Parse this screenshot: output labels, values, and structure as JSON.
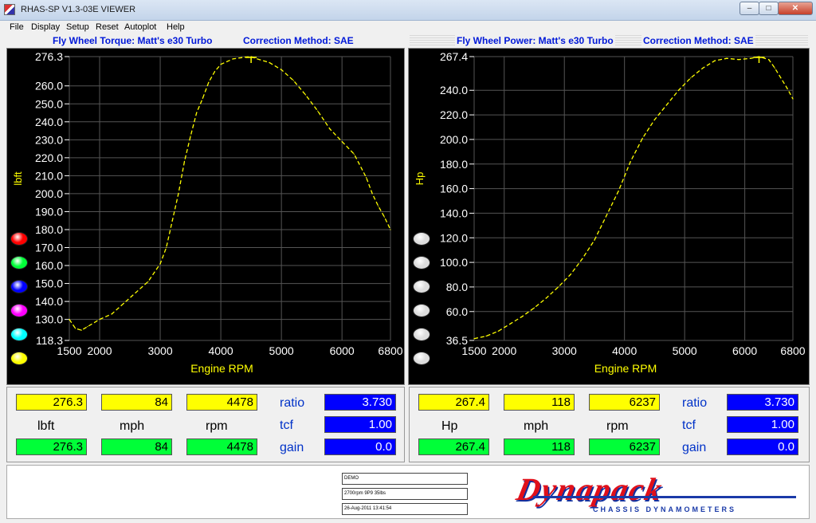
{
  "window": {
    "title": "RHAS-SP V1.3-03E VIEWER",
    "min": "–",
    "max": "□",
    "close": "✕"
  },
  "menu": [
    "File",
    "Display",
    "Setup",
    "Reset",
    "Autoplot",
    "Help"
  ],
  "colors": {
    "trace": "#ffff00",
    "grid": "#555555",
    "axis_text": "#ffffff",
    "axis_label": "#ffff00",
    "title": "#0018d8"
  },
  "torque_panel": {
    "title": "Fly Wheel Torque: Matt's e30 Turbo",
    "method": "Correction Method: SAE",
    "y_unit": "lbft",
    "x_label": "Engine RPM",
    "dots": [
      "#ff0000",
      "#00ff38",
      "#0000ff",
      "#ff00ff",
      "#00ffff",
      "#ffff00"
    ]
  },
  "power_panel": {
    "title": "Fly Wheel Power: Matt's e30 Turbo",
    "method": "Correction Method: SAE",
    "y_unit": "Hp",
    "x_label": "Engine RPM",
    "dots": [
      "#dddddd",
      "#dddddd",
      "#dddddd",
      "#dddddd",
      "#dddddd",
      "#dddddd"
    ]
  },
  "chart_data": [
    {
      "type": "line",
      "title": "Fly Wheel Torque: Matt's e30 Turbo",
      "xlabel": "Engine RPM",
      "ylabel": "lbft",
      "xlim": [
        1500,
        6800
      ],
      "ylim": [
        118.3,
        276.3
      ],
      "x_ticks": [
        1500,
        2000,
        3000,
        4000,
        5000,
        6000,
        6800
      ],
      "y_ticks": [
        118.3,
        130,
        140,
        150,
        160,
        170,
        180,
        190,
        200,
        210,
        220,
        230,
        240,
        250,
        260,
        276.3
      ],
      "y_tick_labels": [
        "118.3",
        "130.0",
        "140.0",
        "150.0",
        "160.0",
        "170.0",
        "180.0",
        "190.0",
        "200.0",
        "210.0",
        "220.0",
        "230.0",
        "240.0",
        "250.0",
        "260.0",
        "276.3"
      ],
      "grid": true,
      "series": [
        {
          "x": [
            1500,
            1600,
            1700,
            1800,
            2000,
            2200,
            2400,
            2600,
            2800,
            3000,
            3100,
            3200,
            3300,
            3400,
            3500,
            3600,
            3700,
            3800,
            3900,
            4000,
            4200,
            4400,
            4500,
            4600,
            4800,
            5000,
            5200,
            5400,
            5600,
            5800,
            6000,
            6200,
            6400,
            6500,
            6600,
            6700,
            6800
          ],
          "y": [
            130,
            125,
            124,
            126,
            130,
            133,
            139,
            145,
            151,
            161,
            170,
            185,
            200,
            218,
            232,
            245,
            253,
            262,
            268,
            272,
            275,
            276,
            276.3,
            275,
            273,
            269,
            263,
            255,
            246,
            236,
            229,
            222,
            209,
            200,
            193,
            187,
            180
          ]
        }
      ]
    },
    {
      "type": "line",
      "title": "Fly Wheel Power: Matt's e30 Turbo",
      "xlabel": "Engine RPM",
      "ylabel": "Hp",
      "xlim": [
        1500,
        6800
      ],
      "ylim": [
        36.5,
        267.4
      ],
      "x_ticks": [
        1500,
        2000,
        3000,
        4000,
        5000,
        6000,
        6800
      ],
      "y_ticks": [
        36.5,
        60,
        80,
        100,
        120,
        140,
        160,
        180,
        200,
        220,
        240,
        267.4
      ],
      "y_tick_labels": [
        "36.5",
        "60.0",
        "80.0",
        "100.0",
        "120.0",
        "140.0",
        "160.0",
        "180.0",
        "200.0",
        "220.0",
        "240.0",
        "267.4"
      ],
      "grid": true,
      "series": [
        {
          "x": [
            1500,
            1700,
            1900,
            2100,
            2300,
            2500,
            2700,
            2900,
            3100,
            3300,
            3500,
            3700,
            3900,
            4100,
            4300,
            4500,
            4700,
            4900,
            5100,
            5300,
            5500,
            5700,
            5900,
            6100,
            6237,
            6400,
            6500,
            6600,
            6700,
            6800
          ],
          "y": [
            38,
            40,
            44,
            50,
            56,
            63,
            71,
            80,
            90,
            103,
            118,
            138,
            158,
            182,
            201,
            216,
            228,
            240,
            250,
            258,
            264,
            266,
            265,
            266,
            267.4,
            265,
            258,
            250,
            242,
            233
          ]
        }
      ]
    }
  ],
  "readout_left": {
    "val1": "276.3",
    "val2": "84",
    "val3": "4478",
    "unit1": "lbft",
    "unit2": "mph",
    "unit3": "rpm",
    "val4": "276.3",
    "val5": "84",
    "val6": "4478",
    "ratio_label": "ratio",
    "ratio": "3.730",
    "tcf_label": "tcf",
    "tcf": "1.00",
    "gain_label": "gain",
    "gain": "0.0"
  },
  "readout_right": {
    "val1": "267.4",
    "val2": "118",
    "val3": "6237",
    "unit1": "Hp",
    "unit2": "mph",
    "unit3": "rpm",
    "val4": "267.4",
    "val5": "118",
    "val6": "6237",
    "ratio_label": "ratio",
    "ratio": "3.730",
    "tcf_label": "tcf",
    "tcf": "1.00",
    "gain_label": "gain",
    "gain": "0.0"
  },
  "footer": {
    "info1": "DEMO",
    "info2": "2700rpm 9P9 35lbs",
    "info3": "26-Aug-2011 13:41:54",
    "logo": "Dynapack",
    "logo_sub": "CHASSIS   DYNAMOMETERS"
  }
}
